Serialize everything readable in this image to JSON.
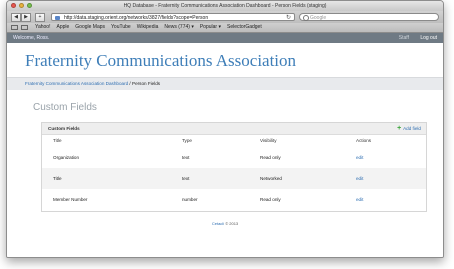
{
  "browser": {
    "title": "HQ Database - Fraternity Communications Association Dashboard - Person Fields (staging)",
    "url": "http://data.staging.orient.org/networks/3827/fields?scope=Person",
    "search_placeholder": "Google",
    "bookmarks": [
      "Yahoo!",
      "Apple",
      "Google Maps",
      "YouTube",
      "Wikipedia",
      "News (774) ▾",
      "Popular ▾",
      "SelectorGadget"
    ]
  },
  "appbar": {
    "welcome": "Welcome, Ross.",
    "staff": "Staff",
    "logout": "Log out"
  },
  "header": {
    "org_title": "Fraternity Communications Association"
  },
  "breadcrumb": {
    "dashboard": "Fraternity Communications Association Dashboard",
    "separator": " / ",
    "current": "Person Fields"
  },
  "page": {
    "title": "Custom Fields"
  },
  "panel": {
    "title": "Custom Fields",
    "add_label": "Add field",
    "columns": [
      "Title",
      "Type",
      "Visibility",
      "Actions"
    ],
    "rows": [
      {
        "title": "Organization",
        "type": "text",
        "visibility": "Read only",
        "action": "edit"
      },
      {
        "title": "Title",
        "type": "text",
        "visibility": "Networked",
        "action": "edit"
      },
      {
        "title": "Member Number",
        "type": "number",
        "visibility": "Read only",
        "action": "edit"
      }
    ]
  },
  "footer": {
    "link": "Cetacli",
    "copyright": " © 2013"
  }
}
